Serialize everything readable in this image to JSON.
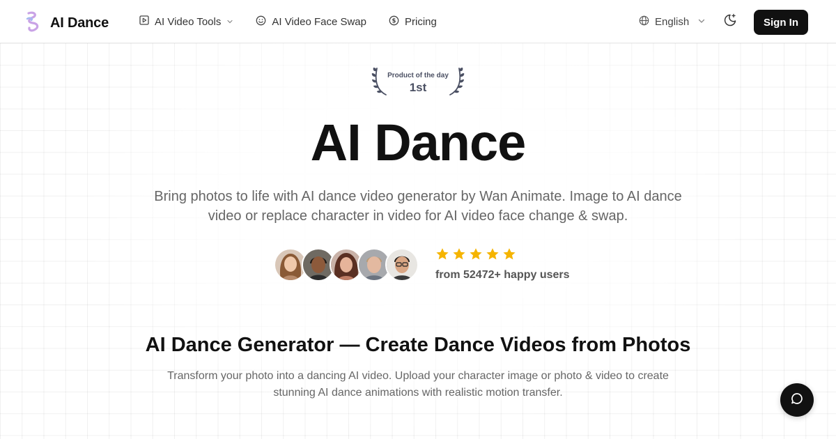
{
  "header": {
    "brand_name": "AI Dance",
    "nav": [
      {
        "label": "AI Video Tools",
        "icon": "play-square-icon",
        "has_dropdown": true
      },
      {
        "label": "AI Video Face Swap",
        "icon": "smile-icon"
      },
      {
        "label": "Pricing",
        "icon": "dollar-circle-icon"
      }
    ],
    "language": "English",
    "sign_in": "Sign In"
  },
  "badge": {
    "caption": "Product of the day",
    "rank": "1st"
  },
  "hero": {
    "title": "AI Dance",
    "subtitle": "Bring photos to life with AI dance video generator by Wan Animate. Image to AI dance video or replace character in video for AI video face change & swap.",
    "rating_stars": 5,
    "users_text": "from 52472+ happy users"
  },
  "section": {
    "title": "AI Dance Generator — Create Dance Videos from Photos",
    "subtitle": "Transform your photo into a dancing AI video. Upload your character image or photo & video to create stunning AI dance animations with realistic motion transfer."
  },
  "colors": {
    "primary": "#111111",
    "star": "#f5b400",
    "muted_text": "#666666",
    "badge_text": "#4b5063"
  }
}
